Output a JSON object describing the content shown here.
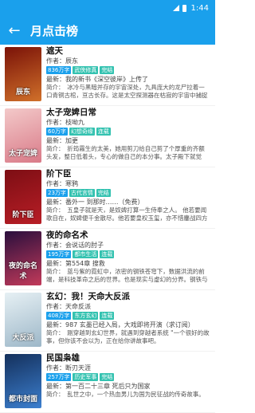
{
  "status": {
    "time": "1:44"
  },
  "header": {
    "title": "月点击榜"
  },
  "books": [
    {
      "title": "遮天",
      "author": "作者：辰东",
      "tags": [
        "836万字",
        "武侠修真",
        "完结"
      ],
      "latest": "最新：我的新书《深空彼岸》上传了",
      "desc": "简介：　冰冷与黑暗并存的宇宙深处，九具庞大的龙尸拉着一口青铜古棺，亘古长存。这是太空探测器在枯寂的宇宙中捕捉到的",
      "cover_word": "辰东",
      "cover_colors": [
        "#7a1208",
        "#d0702a"
      ]
    },
    {
      "title": "太子宠婢日常",
      "author": "作者：枝呦九",
      "tags": [
        "60万字",
        "幻想奇缘",
        "连载"
      ],
      "latest": "最新：加更",
      "desc": "简介：　折筠霧生的太美，她用剪刀给自己剪了个厚重的齐额头发，整日低着头，专心的做自己的本分事。太子殿下就觉",
      "cover_word": "太子宠婢",
      "cover_colors": [
        "#f3c9c9",
        "#d97a88"
      ]
    },
    {
      "title": "阶下臣",
      "author": "作者：寒鸦",
      "tags": [
        "23万字",
        "古代言情",
        "完结"
      ],
      "latest": "最新：番外一 到那时……（免费）",
      "desc": "简介：　五皇子就是天，是奴婢打算一生侍奉之人。 他若要闻歌自在，奴婢便千金散尽。他若要皇权玉玺，亦不惜鏖战四方",
      "cover_word": "阶下臣",
      "cover_colors": [
        "#7d0e14",
        "#b81e26"
      ]
    },
    {
      "title": "夜的命名术",
      "author": "作者：会说话的肘子",
      "tags": [
        "195万字",
        "都市生活",
        "连载"
      ],
      "latest": "最新：第554章 搜救",
      "desc": "简介：　蓝与紫的霓虹中，浓密的钢铁苍穹下，数据洪流的前端，是科技革命之后的世界。也是现实与虚幻的分界。钢铁与",
      "cover_word": "夜的命名术",
      "cover_colors": [
        "#2a0f3d",
        "#c23a5a"
      ]
    },
    {
      "title": "玄幻：我！天命大反派",
      "author": "作者：天命反派",
      "tags": [
        "408万字",
        "东方玄幻",
        "连载"
      ],
      "latest": "最新：987 玄墨已经入局，大戏即将开演（求订阅）",
      "desc": "简介：　刚穿越到玄幻世界，就遇到穿越者系统 \"一个很好的故事，但你该不会以为，正在给你讲故事吧。",
      "cover_word": "大反派",
      "cover_colors": [
        "#e6f0f4",
        "#9db7c8"
      ]
    },
    {
      "title": "民国枭雄",
      "author": "作者：断刃天涯",
      "tags": [
        "257万字",
        "历史军事",
        "完结"
      ],
      "latest": "最新：第一百二十三章 死后只为国家",
      "desc": "简介：　乱世之中，一个热血男儿为国为民征战的传奇故事。",
      "cover_word": "都市封面",
      "cover_colors": [
        "#14305c",
        "#3c7fcf"
      ]
    }
  ]
}
